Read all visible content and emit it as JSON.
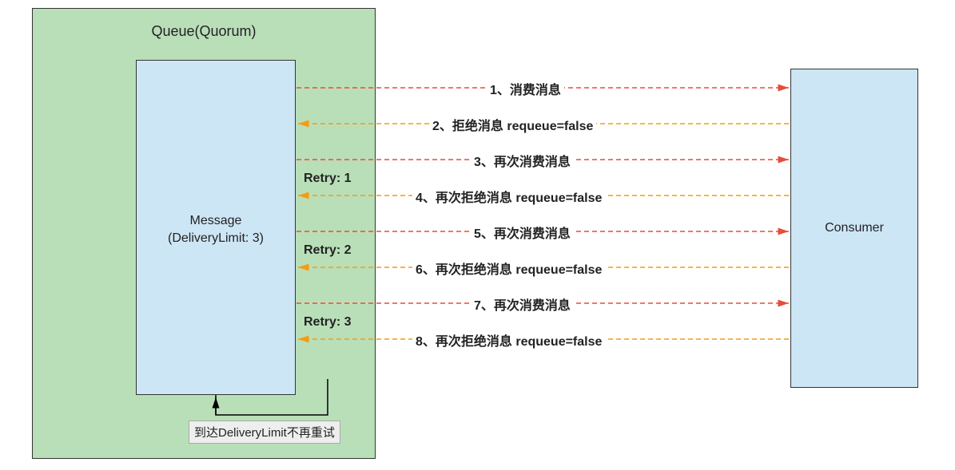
{
  "queue": {
    "title": "Queue(Quorum)",
    "message_line1": "Message",
    "message_line2": "(DeliveryLimit: 3)"
  },
  "consumer": {
    "label": "Consumer"
  },
  "retry": {
    "r1": "Retry: 1",
    "r2": "Retry: 2",
    "r3": "Retry: 3"
  },
  "steps": {
    "s1": "1、消费消息",
    "s2": "2、拒绝消息 requeue=false",
    "s3": "3、再次消费消息",
    "s4": "4、再次拒绝消息 requeue=false",
    "s5": "5、再次消费消息",
    "s6": "6、再次拒绝消息 requeue=false",
    "s7": "7、再次消费消息",
    "s8": "8、再次拒绝消息 requeue=false"
  },
  "footer": {
    "label": "到达DeliveryLimit不再重试"
  },
  "colors": {
    "queue_bg": "#b9dfb9",
    "box_bg": "#cde6f6",
    "to_consumer": "#e74c3c",
    "from_consumer": "#f39c12",
    "solid_arrow": "#000000"
  }
}
